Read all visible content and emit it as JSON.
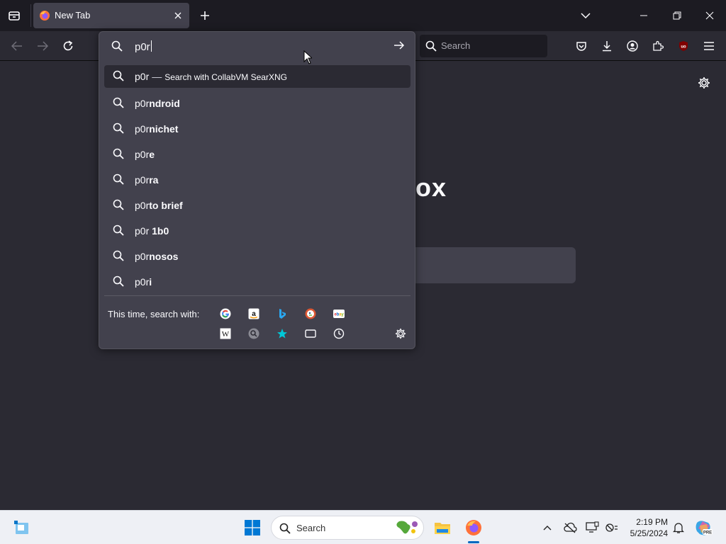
{
  "tab": {
    "title": "New Tab"
  },
  "navbar": {
    "search_placeholder": "Search"
  },
  "urlbar": {
    "value": "p0r",
    "results": [
      {
        "typed": "p0r",
        "suffix": "",
        "action": "Search with CollabVM SearXNG",
        "selected": true
      },
      {
        "typed": "p0r",
        "suffix": "ndroid"
      },
      {
        "typed": "p0r",
        "suffix": "nichet"
      },
      {
        "typed": "p0r",
        "suffix": "e"
      },
      {
        "typed": "p0r",
        "suffix": "ra"
      },
      {
        "typed": "p0r",
        "suffix": "to brief"
      },
      {
        "typed": "p0r",
        "suffix": " 1b0"
      },
      {
        "typed": "p0r",
        "suffix": "nosos"
      },
      {
        "typed": "p0r",
        "suffix": "i"
      }
    ],
    "oneoff_label": "This time, search with:",
    "engines_row1": [
      "google-icon",
      "amazon-icon",
      "bing-icon",
      "duckduckgo-icon",
      "ebay-icon"
    ],
    "engines_row2": [
      "wikipedia-icon",
      "searxng-icon",
      "bookmarks-icon",
      "tabs-icon",
      "history-icon"
    ]
  },
  "content": {
    "brand_tail": "ox"
  },
  "taskbar": {
    "search_label": "Search",
    "time": "2:19 PM",
    "date": "5/25/2024"
  }
}
